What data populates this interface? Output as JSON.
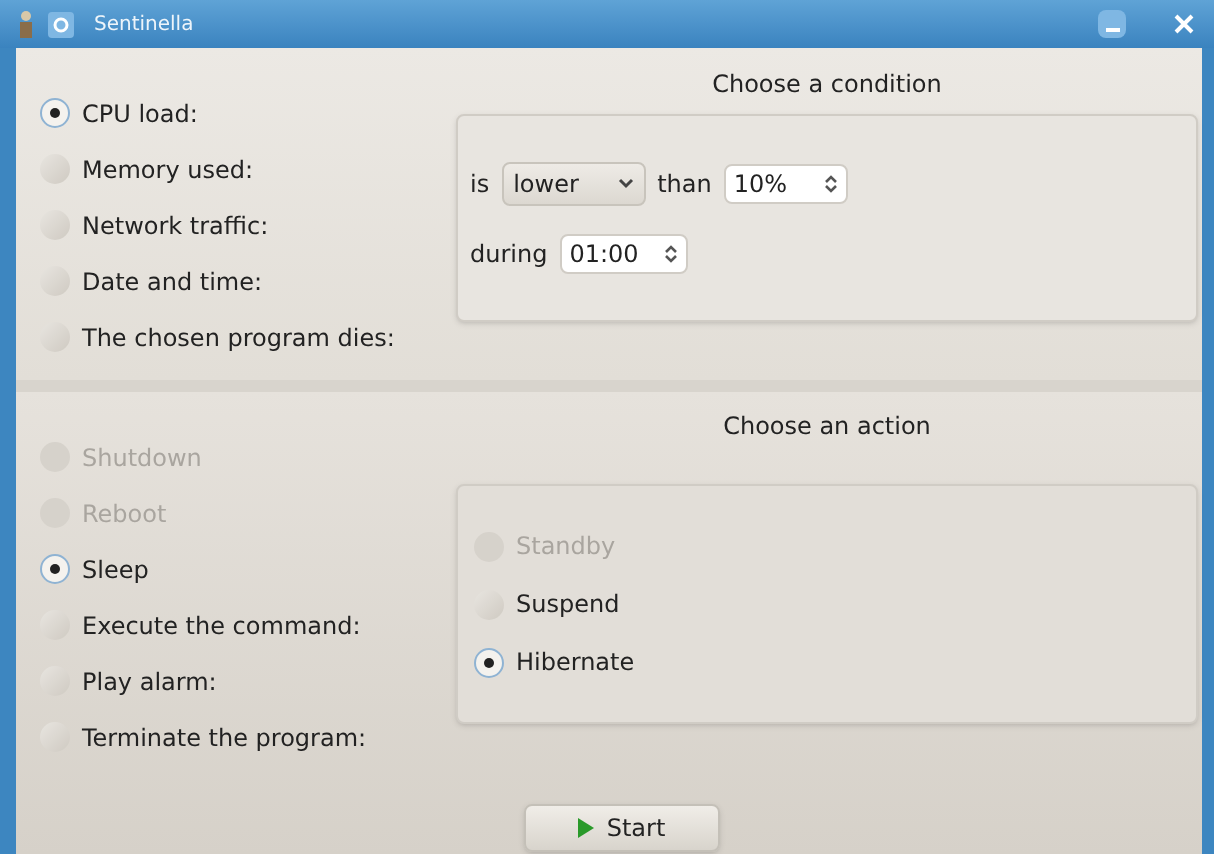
{
  "window": {
    "title": "Sentinella"
  },
  "conditions": [
    {
      "label": "CPU load:",
      "selected": true
    },
    {
      "label": "Memory used:",
      "selected": false
    },
    {
      "label": "Network traffic:",
      "selected": false
    },
    {
      "label": "Date and time:",
      "selected": false
    },
    {
      "label": "The chosen program dies:",
      "selected": false
    }
  ],
  "condition_panel": {
    "title": "Choose a condition",
    "is_label": "is",
    "comparison": "lower",
    "than_label": "than",
    "threshold": "10%",
    "during_label": "during",
    "duration": "01:00"
  },
  "actions": [
    {
      "label": "Shutdown",
      "selected": false,
      "disabled": true
    },
    {
      "label": "Reboot",
      "selected": false,
      "disabled": true
    },
    {
      "label": "Sleep",
      "selected": true,
      "disabled": false
    },
    {
      "label": "Execute the command:",
      "selected": false,
      "disabled": false
    },
    {
      "label": "Play alarm:",
      "selected": false,
      "disabled": false
    },
    {
      "label": "Terminate the program:",
      "selected": false,
      "disabled": false
    }
  ],
  "action_panel": {
    "title": "Choose an action",
    "options": [
      {
        "label": "Standby",
        "selected": false,
        "disabled": true
      },
      {
        "label": "Suspend",
        "selected": false,
        "disabled": false
      },
      {
        "label": "Hibernate",
        "selected": true,
        "disabled": false
      }
    ]
  },
  "start_button": "Start"
}
